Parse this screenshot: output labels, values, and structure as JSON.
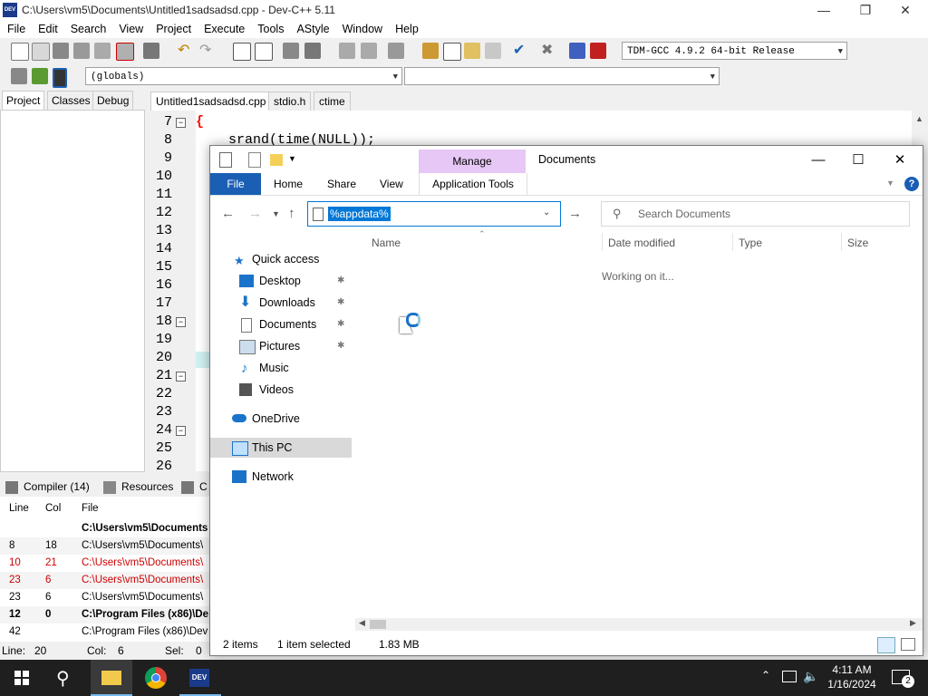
{
  "devcpp": {
    "window_title": "C:\\Users\\vm5\\Documents\\Untitled1sadsadsd.cpp - Dev-C++ 5.11",
    "app_icon_text": "DEV",
    "menu": [
      "File",
      "Edit",
      "Search",
      "View",
      "Project",
      "Execute",
      "Tools",
      "AStyle",
      "Window",
      "Help"
    ],
    "compiler_select": "TDM-GCC 4.9.2 64-bit Release",
    "scope_select": "(globals)",
    "left_tabs": [
      "Project",
      "Classes",
      "Debug"
    ],
    "editor_tabs": [
      "Untitled1sadsadsd.cpp",
      "stdio.h",
      "ctime"
    ],
    "line_numbers": [
      "7",
      "8",
      "9",
      "10",
      "11",
      "12",
      "13",
      "14",
      "15",
      "16",
      "17",
      "18",
      "19",
      "20",
      "21",
      "22",
      "23",
      "24",
      "25",
      "26"
    ],
    "code_line_7": "{",
    "code_line_8": "srand(time(NULL));",
    "bottom_tabs": [
      "Compiler (14)",
      "Resources",
      "C"
    ],
    "compiler_headers": {
      "line": "Line",
      "col": "Col",
      "file": "File"
    },
    "compiler_rows": [
      {
        "line": "",
        "col": "",
        "file": "C:\\Users\\vm5\\Documents",
        "style": "bold"
      },
      {
        "line": "8",
        "col": "18",
        "file": "C:\\Users\\vm5\\Documents\\",
        "style": "normal"
      },
      {
        "line": "10",
        "col": "21",
        "file": "C:\\Users\\vm5\\Documents\\",
        "style": "red"
      },
      {
        "line": "23",
        "col": "6",
        "file": "C:\\Users\\vm5\\Documents\\",
        "style": "red"
      },
      {
        "line": "23",
        "col": "6",
        "file": "C:\\Users\\vm5\\Documents\\",
        "style": "normal"
      },
      {
        "line": "12",
        "col": "0",
        "file": "C:\\Program Files (x86)\\De",
        "style": "bold"
      },
      {
        "line": "42",
        "col": "",
        "file": "C:\\Program Files (x86)\\Dev",
        "style": "normal"
      }
    ],
    "status": {
      "line_label": "Line:",
      "line_value": "20",
      "col_label": "Col:",
      "col_value": "6",
      "sel_label": "Sel:",
      "sel_value": "0"
    }
  },
  "explorer": {
    "title": "Documents",
    "context_tab": "Manage",
    "ribbon_tabs": [
      "File",
      "Home",
      "Share",
      "View",
      "Application Tools"
    ],
    "address_value": "%appdata%",
    "search_placeholder": "Search Documents",
    "nav": {
      "quick_access": "Quick access",
      "desktop": "Desktop",
      "downloads": "Downloads",
      "documents": "Documents",
      "pictures": "Pictures",
      "music": "Music",
      "videos": "Videos",
      "onedrive": "OneDrive",
      "this_pc": "This PC",
      "network": "Network"
    },
    "columns": {
      "name": "Name",
      "date_modified": "Date modified",
      "type": "Type",
      "size": "Size"
    },
    "loading_text": "Working on it...",
    "status": {
      "items": "2 items",
      "selected": "1 item selected",
      "size": "1.83 MB"
    }
  },
  "taskbar": {
    "time": "4:11 AM",
    "date": "1/16/2024",
    "notification_count": "2",
    "devcpp_label": "DEV"
  },
  "colors": {
    "accent": "#0078d7",
    "file_tab": "#1a5fb4",
    "manage_tab": "#e6c7f5",
    "error_red": "#cc0000",
    "code_red": "#ff0000"
  }
}
